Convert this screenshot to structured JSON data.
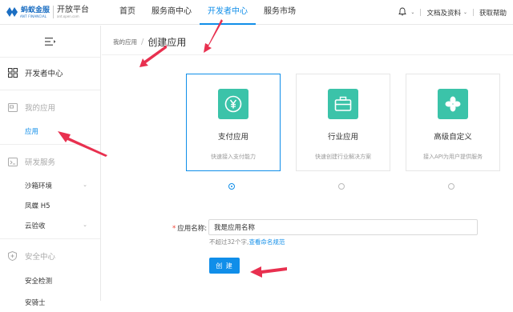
{
  "logo": {
    "cn": "蚂蚁金服",
    "en": "ANT FINANCIAL",
    "title": "开放平台",
    "sub": "ant.open.com"
  },
  "nav": [
    {
      "label": "首页",
      "active": false
    },
    {
      "label": "服务商中心",
      "active": false
    },
    {
      "label": "开发者中心",
      "active": true
    },
    {
      "label": "服务市场",
      "active": false
    }
  ],
  "topright": {
    "docs": "文档及资料",
    "help": "获取帮助"
  },
  "sidebar": {
    "dev_center": "开发者中心",
    "my_apps": "我的应用",
    "app_item": "应用",
    "dev_services": "研发服务",
    "sandbox": "沙箱环境",
    "fengdie": "凤蝶 H5",
    "cloud_test": "云验收",
    "security_center": "安全中心",
    "security_check": "安全检测",
    "security_guard": "安骑士"
  },
  "breadcrumb": {
    "parent": "我的应用",
    "current": "创建应用"
  },
  "cards": [
    {
      "title": "支付应用",
      "desc": "快速接入支付能力",
      "icon": "yen-icon",
      "selected": true
    },
    {
      "title": "行业应用",
      "desc": "快速创建行业解决方案",
      "icon": "briefcase-icon",
      "selected": false
    },
    {
      "title": "高级自定义",
      "desc": "接入API为用户提供服务",
      "icon": "clover-icon",
      "selected": false
    }
  ],
  "form": {
    "label": "应用名称:",
    "value": "我是应用名称",
    "hint": "不超过32个字,",
    "hint_link": "查看命名规范",
    "button": "创 建"
  },
  "colors": {
    "accent": "#108ee9",
    "card_icon_bg": "#3bc3a9",
    "arrow": "#e8304f"
  }
}
